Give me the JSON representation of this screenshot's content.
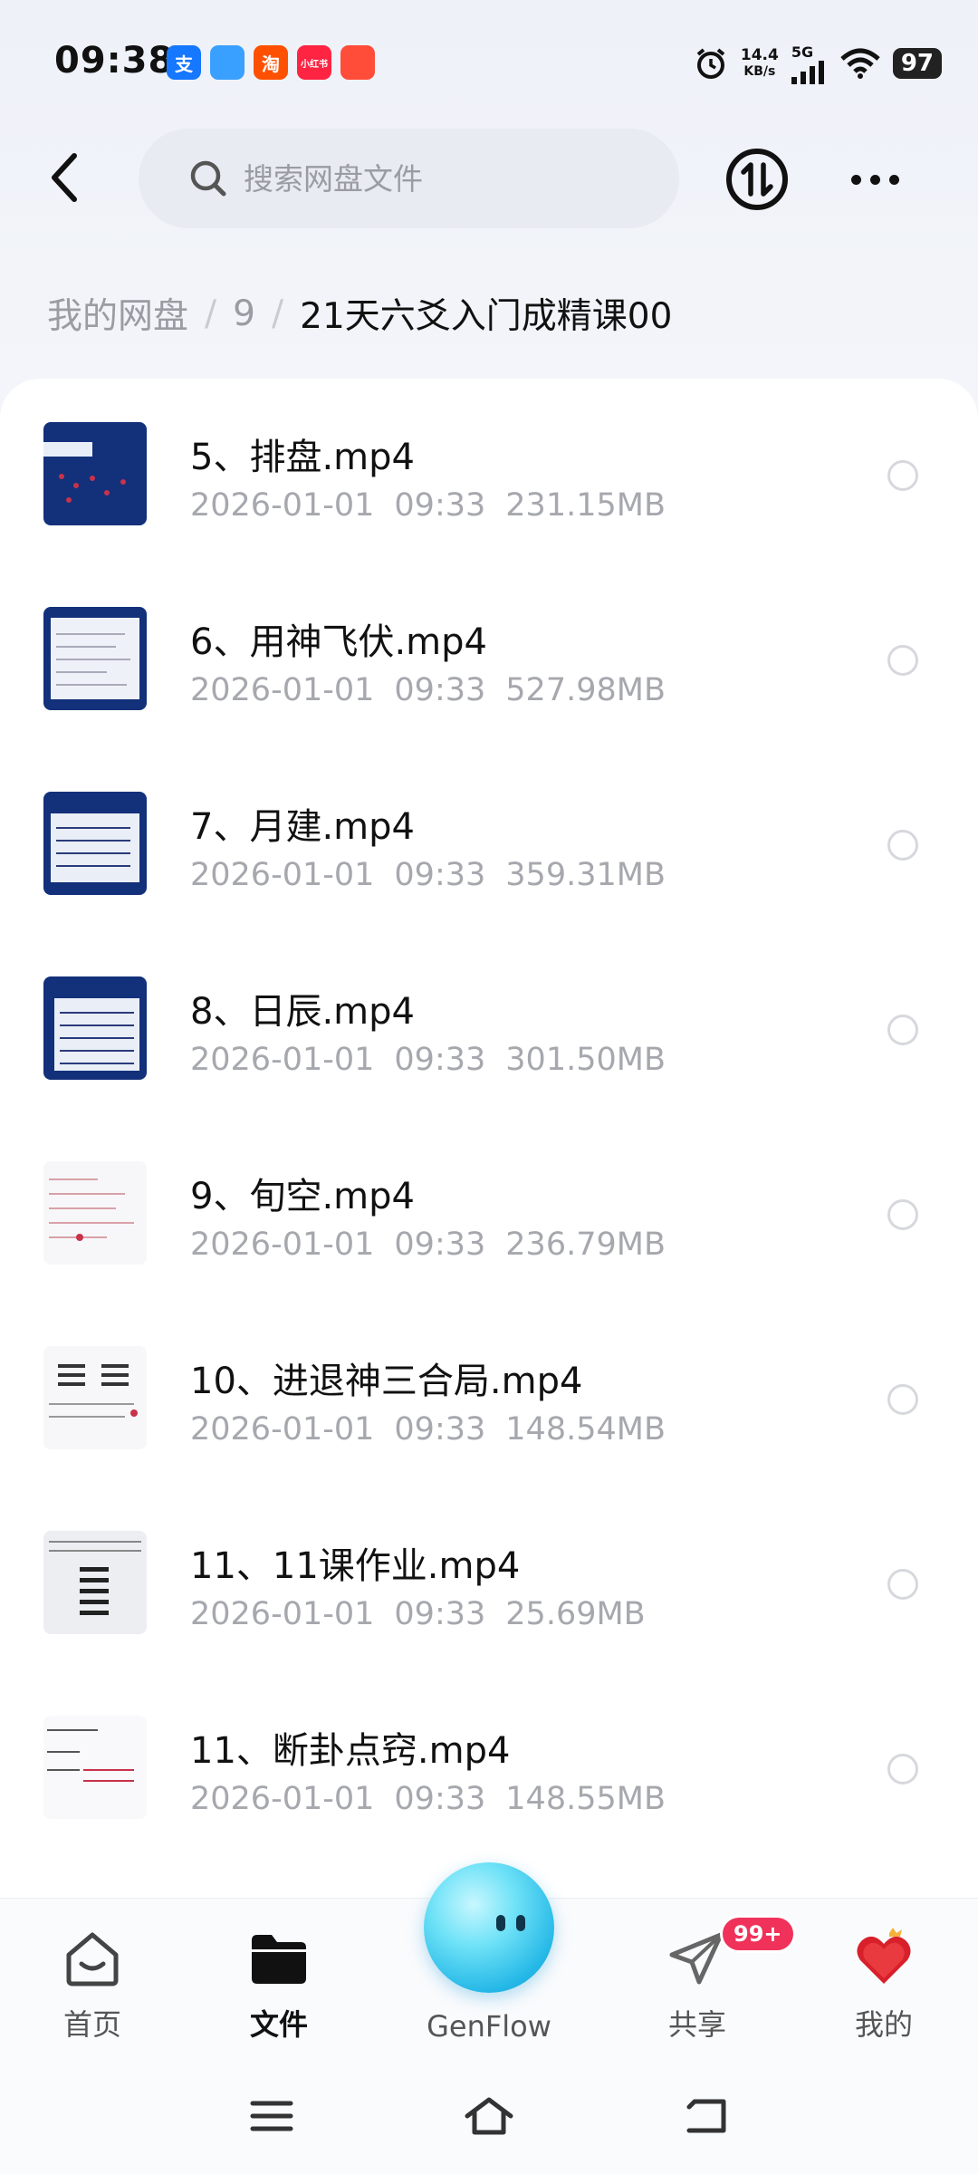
{
  "status_bar": {
    "time": "09:38",
    "apps": [
      {
        "icon": "alipay-icon",
        "glyph": "支",
        "color": "#1677ff"
      },
      {
        "icon": "app-icon",
        "glyph": "",
        "color": "#3aa0ff"
      },
      {
        "icon": "taobao-icon",
        "glyph": "淘",
        "color": "#ff5000"
      },
      {
        "icon": "xiaohongshu-icon",
        "glyph": "小红书",
        "color": "#ff2442"
      },
      {
        "icon": "app-icon",
        "glyph": "",
        "color": "#ff4d3a"
      }
    ],
    "net_speed_value": "14.4",
    "net_speed_unit": "KB/s",
    "network": "5G",
    "battery": "97"
  },
  "header": {
    "search_placeholder": "搜索网盘文件"
  },
  "breadcrumb": {
    "items": [
      "我的网盘",
      "9"
    ],
    "current": "21天六爻入门成精课00"
  },
  "files": [
    {
      "name": "5、排盘.mp4",
      "date": "2026-01-01",
      "time": "09:33",
      "size": "231.15MB",
      "thumb": "dark"
    },
    {
      "name": "6、用神飞伏.mp4",
      "date": "2026-01-01",
      "time": "09:33",
      "size": "527.98MB",
      "thumb": "dark"
    },
    {
      "name": "7、月建.mp4",
      "date": "2026-01-01",
      "time": "09:33",
      "size": "359.31MB",
      "thumb": "dark"
    },
    {
      "name": "8、日辰.mp4",
      "date": "2026-01-01",
      "time": "09:33",
      "size": "301.50MB",
      "thumb": "dark"
    },
    {
      "name": "9、旬空.mp4",
      "date": "2026-01-01",
      "time": "09:33",
      "size": "236.79MB",
      "thumb": "light"
    },
    {
      "name": "10、进退神三合局.mp4",
      "date": "2026-01-01",
      "time": "09:33",
      "size": "148.54MB",
      "thumb": "light"
    },
    {
      "name": "11、11课作业.mp4",
      "date": "2026-01-01",
      "time": "09:33",
      "size": "25.69MB",
      "thumb": "light"
    },
    {
      "name": "11、断卦点窍.mp4",
      "date": "2026-01-01",
      "time": "09:33",
      "size": "148.55MB",
      "thumb": "light"
    }
  ],
  "bottom_nav": {
    "home": "首页",
    "files": "文件",
    "genflow": "GenFlow",
    "share": "共享",
    "share_badge": "99+",
    "mine": "我的"
  },
  "colors": {
    "accent_badge": "#f0315a",
    "thumb_dark": "#13307a"
  }
}
